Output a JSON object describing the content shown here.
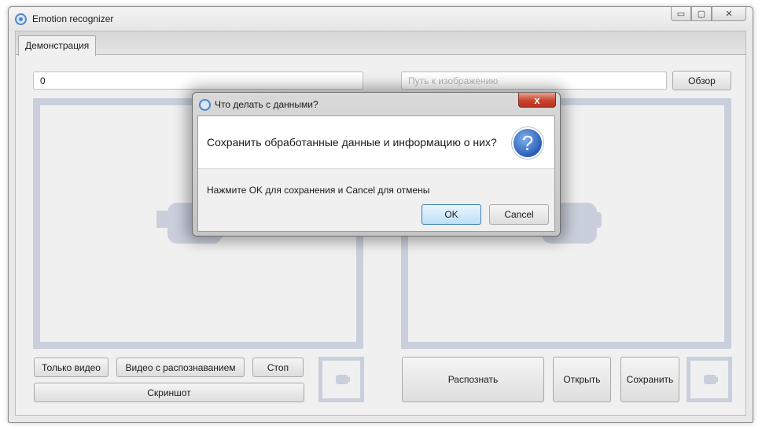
{
  "window": {
    "title": "Emotion recognizer",
    "controls": {
      "minimize": "▭",
      "maximize": "▢",
      "close": "✕"
    }
  },
  "tabs": [
    {
      "label": "Демонстрация"
    }
  ],
  "left": {
    "input_value": "0",
    "buttons": {
      "video_only": "Только видео",
      "video_recognition": "Видео с распознаванием",
      "stop": "Стоп",
      "screenshot": "Скриншот"
    }
  },
  "right": {
    "path_placeholder": "Путь к изображению",
    "browse": "Обзор",
    "buttons": {
      "recognize": "Распознать",
      "open": "Открыть",
      "save": "Сохранить"
    }
  },
  "dialog": {
    "title": "Что делать с данными?",
    "close": "x",
    "question": "Сохранить обработанные данные и информацию о них?",
    "question_icon": "?",
    "detail": "Нажмите OK для сохранения и Cancel для отмены",
    "ok": "OK",
    "cancel": "Cancel"
  },
  "colors": {
    "panel_border": "#c9d0dc",
    "dialog_close": "#c9442f",
    "ok_border": "#3c7fb1"
  }
}
